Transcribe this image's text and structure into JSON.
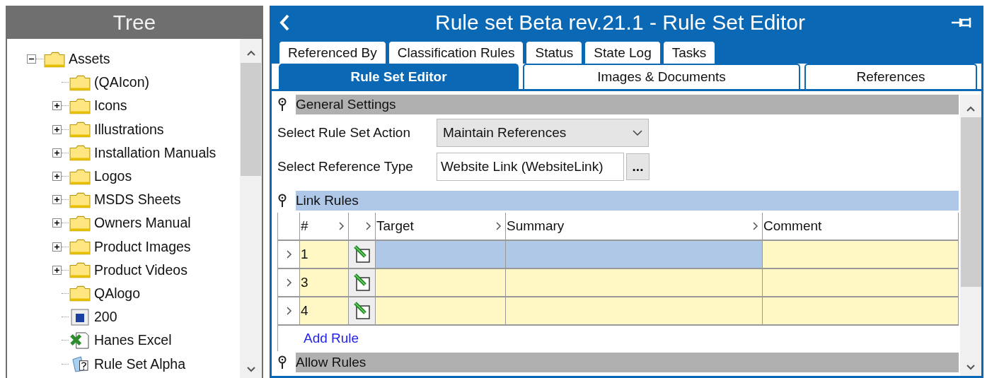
{
  "tree": {
    "title": "Tree",
    "items": [
      {
        "label": "Assets",
        "kind": "folder",
        "expanded": true,
        "children": [
          {
            "label": "(QAIcon)",
            "kind": "folder"
          },
          {
            "label": "Icons",
            "kind": "folder",
            "expanded": false
          },
          {
            "label": "Illustrations",
            "kind": "folder",
            "expanded": false
          },
          {
            "label": "Installation Manuals",
            "kind": "folder",
            "expanded": false
          },
          {
            "label": "Logos",
            "kind": "folder",
            "expanded": false
          },
          {
            "label": "MSDS Sheets",
            "kind": "folder",
            "expanded": false
          },
          {
            "label": "Owners Manual",
            "kind": "folder",
            "expanded": false
          },
          {
            "label": "Product Images",
            "kind": "folder",
            "expanded": false
          },
          {
            "label": "Product Videos",
            "kind": "folder",
            "expanded": false
          },
          {
            "label": "QAlogo",
            "kind": "folder"
          },
          {
            "label": "200",
            "kind": "image"
          },
          {
            "label": "Hanes Excel",
            "kind": "excel"
          },
          {
            "label": "Rule Set Alpha",
            "kind": "ruleset"
          }
        ]
      }
    ]
  },
  "editor": {
    "title": "Rule set Beta rev.21.1 - Rule Set Editor",
    "tabs_top": [
      {
        "label": "Referenced By",
        "selected": false
      },
      {
        "label": "Classification Rules",
        "selected": false
      },
      {
        "label": "Status",
        "selected": false
      },
      {
        "label": "State Log",
        "selected": false
      },
      {
        "label": "Tasks",
        "selected": false
      }
    ],
    "tabs_bottom": [
      {
        "label": "Rule Set Editor",
        "selected": true
      },
      {
        "label": "Images & Documents",
        "selected": false
      },
      {
        "label": "References",
        "selected": false
      }
    ],
    "general_settings": {
      "title": "General Settings",
      "selected": false,
      "rule_set_action": {
        "label": "Select Rule Set Action",
        "value": "Maintain References"
      },
      "reference_type": {
        "label": "Select Reference Type",
        "value": "Website Link (WebsiteLink)",
        "button": "..."
      }
    },
    "link_rules": {
      "title": "Link Rules",
      "selected": true,
      "columns": [
        "#",
        "",
        "Target",
        "Summary",
        "Comment"
      ],
      "rows": [
        {
          "number": "1",
          "selected": true
        },
        {
          "number": "3",
          "selected": false
        },
        {
          "number": "4",
          "selected": false
        }
      ],
      "add_link": "Add Rule"
    },
    "allow_rules": {
      "title": "Allow Rules",
      "selected": false
    }
  }
}
